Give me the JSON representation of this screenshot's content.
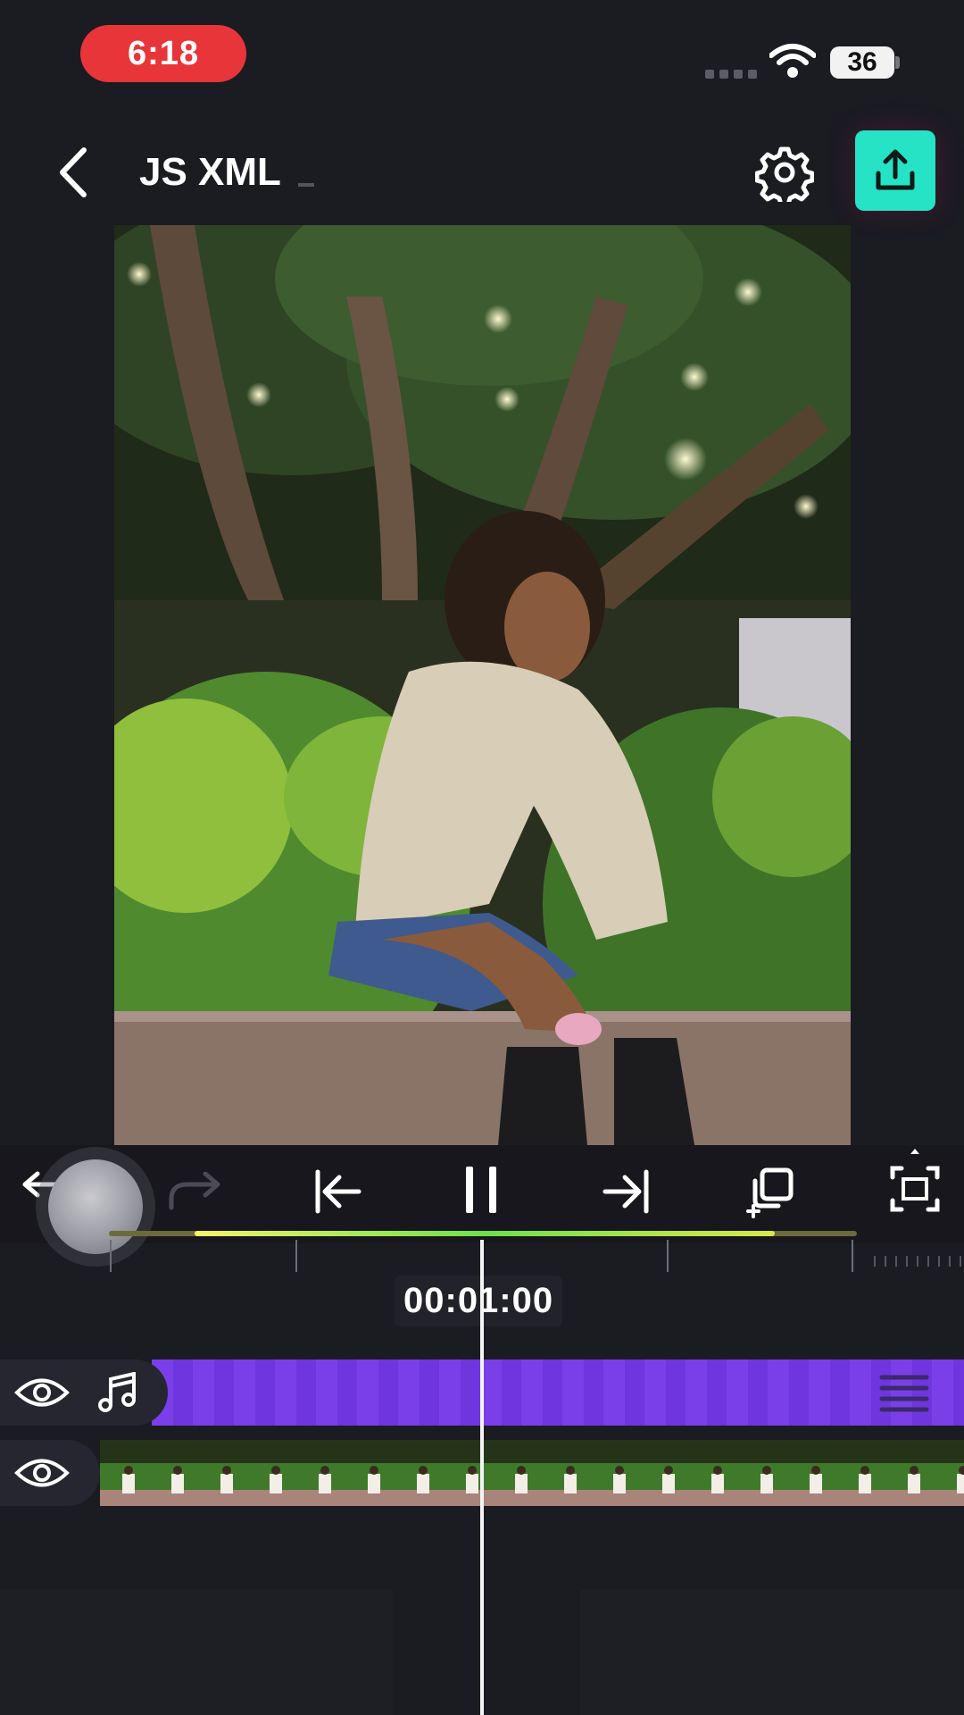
{
  "status_bar": {
    "time": "6:18",
    "battery_level": "36",
    "icons": [
      "wifi-icon",
      "battery-icon"
    ]
  },
  "header": {
    "title": "JS XML",
    "icons": [
      "chevron-left-icon",
      "gear-icon",
      "share-upload-icon"
    ],
    "accent_color": "#25e3c4"
  },
  "preview": {
    "icons": [
      "photo-preview"
    ]
  },
  "controls": {
    "icons": [
      "undo-icon",
      "redo-icon",
      "skip-to-start-icon",
      "pause-icon",
      "skip-to-end-icon",
      "duplicate-icon",
      "fullscreen-icon"
    ],
    "redo_enabled": false
  },
  "timeline": {
    "timecode": "00:01:00",
    "tracks": [
      {
        "type": "audio",
        "visible": true,
        "icons": [
          "eye-icon",
          "music-note-icon",
          "drag-handle-icon"
        ],
        "color": "#7a3fe8"
      },
      {
        "type": "video",
        "visible": true,
        "icons": [
          "eye-icon",
          "thumbnail-strip"
        ]
      }
    ]
  }
}
